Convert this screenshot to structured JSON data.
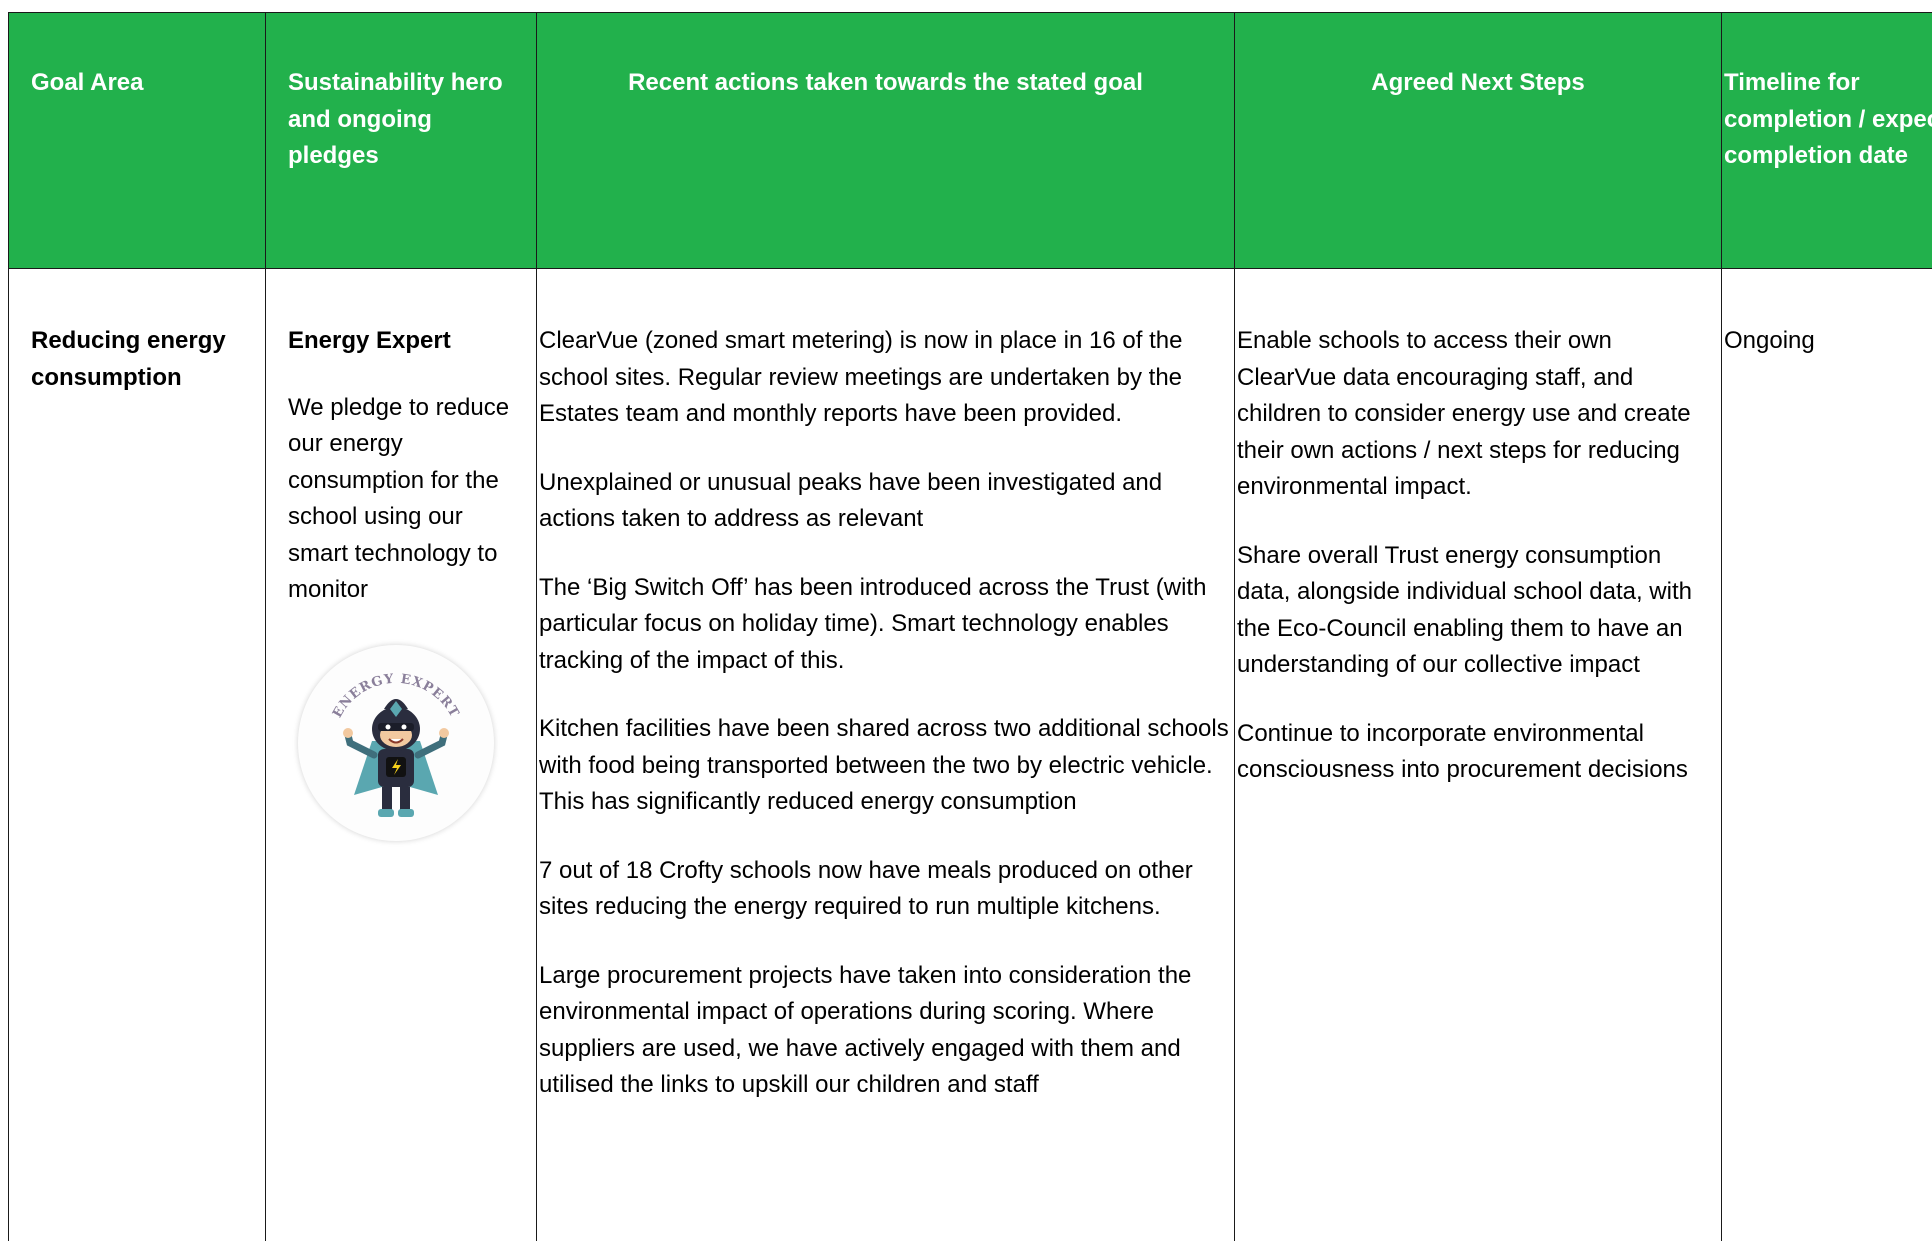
{
  "headers": {
    "goal_area": "Goal Area",
    "hero": "Sustainability hero and ongoing pledges",
    "recent_actions": "Recent actions taken towards the stated goal",
    "next_steps": "Agreed Next Steps",
    "timeline": "Timeline for completion / expected completion date"
  },
  "row": {
    "goal_area": "Reducing energy consumption",
    "hero_name": "Energy Expert",
    "pledge": "We pledge to reduce our energy consumption for the school using our smart technology to monitor",
    "badge": {
      "icon": "energy-expert-hero-icon",
      "caption": "ENERGY EXPERT"
    },
    "recent_actions": [
      "ClearVue (zoned smart metering) is now in place in 16 of the school sites.  Regular review meetings are undertaken by the Estates team and monthly reports have been provided.",
      "Unexplained or unusual peaks have been investigated and actions taken to address as relevant",
      "The ‘Big Switch Off’ has been introduced across the Trust (with particular focus on holiday time).  Smart technology enables tracking of the impact of this.",
      "Kitchen facilities have been shared across two additional schools with food being transported between the two by electric vehicle.  This has significantly reduced energy consumption",
      "7 out of 18 Crofty schools now have meals produced on other sites reducing the energy required to run multiple kitchens.",
      "Large procurement projects have taken into consideration the environmental impact of operations during scoring.  Where suppliers are used, we have actively engaged with them and utilised the links to upskill our children and staff"
    ],
    "next_steps": [
      "Enable schools to access their own ClearVue data encouraging staff, and children to consider energy use and create their own actions / next steps for reducing environmental impact.",
      "Share overall Trust energy consumption data, alongside individual school data, with the Eco-Council enabling them to have an understanding of our collective impact",
      "Continue to incorporate environmental consciousness into procurement decisions"
    ],
    "timeline": "Ongoing"
  },
  "colors": {
    "header_background": "#22b14c",
    "header_text": "#ffffff",
    "border": "#1a1a1a"
  }
}
